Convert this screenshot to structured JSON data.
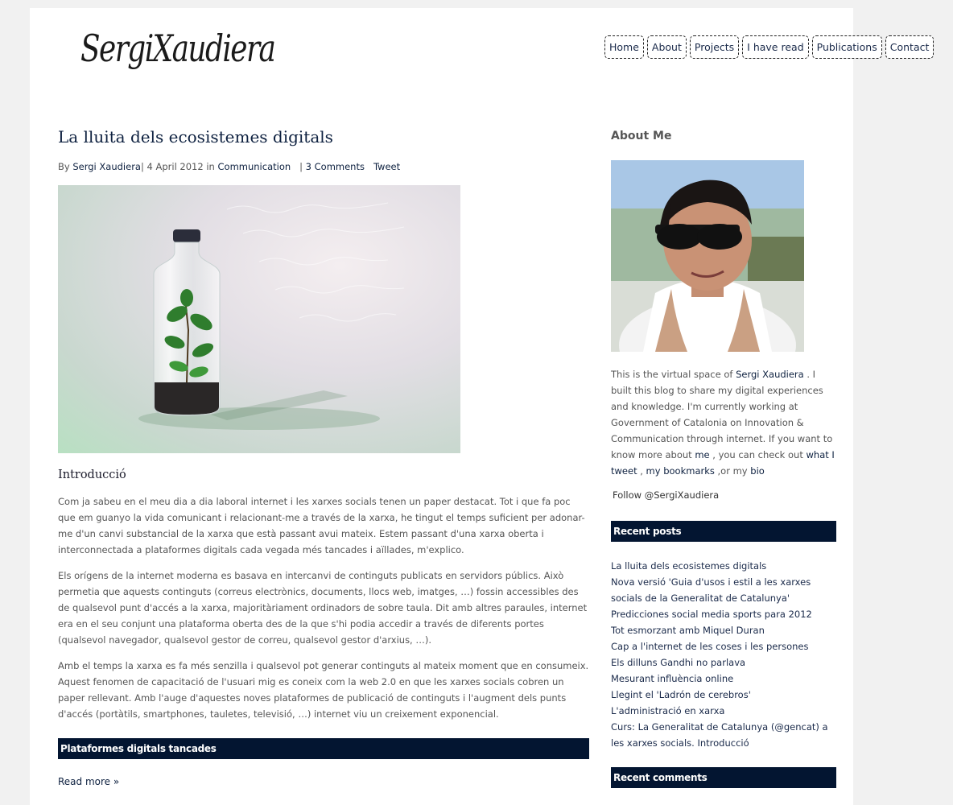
{
  "header": {
    "logo_text": "SergiXaudiera",
    "nav": [
      "Home",
      "About",
      "Projects",
      "I have read",
      "Publications",
      "Contact"
    ]
  },
  "post": {
    "title": "La lluita dels ecosistemes digitals",
    "meta": {
      "by": "By",
      "author": "Sergi Xaudiera",
      "date": "| 4 April 2012 in",
      "category": "Communication",
      "comments_sep": "|",
      "comments": "3 Comments",
      "tweet": "Tweet"
    },
    "intro_heading": "Introducció",
    "paragraphs": [
      "Com ja sabeu en el meu dia a dia laboral internet i les xarxes socials tenen un paper destacat. Tot i que fa poc que em guanyo la vida comunicant i relacionant-me a través de la xarxa, he tingut el temps suficient per adonar-me d'un canvi substancial de la xarxa que està passant avui mateix. Estem passant d'una xarxa oberta i interconnectada a plataformes digitals cada vegada més tancades i aïllades, m'explico.",
      "Els orígens de la internet moderna es basava en intercanvi de continguts publicats en servidors públics. Això permetia que aquests continguts (correus electrònics, documents, llocs web, imatges, …) fossin accessibles des de qualsevol punt d'accés a la xarxa, majoritàriament ordinadors de sobre taula. Dit amb altres paraules, internet era en el seu conjunt una plataforma oberta des de la que s'hi podia accedir a través de diferents portes (qualsevol navegador, qualsevol  gestor de correu, qualsevol gestor d'arxius, …).",
      "Amb el temps la xarxa es fa més senzilla i qualsevol pot generar continguts al mateix moment que en consumeix. Aquest fenomen de capacitació de l'usuari mig es coneix com la web 2.0 en que les xarxes socials cobren un paper rellevant. Amb l'auge d'aquestes noves plataformes de publicació de continguts i l'augment dels punts d'accés (portàtils, smartphones, tauletes, televisió, …) internet viu un creixement exponencial."
    ],
    "subheading": "Plataformes digitals tancades",
    "read_more": "Read more »"
  },
  "sidebar": {
    "about_title": "About Me",
    "bio": {
      "t1": "This is the virtual space of ",
      "l1": "Sergi Xaudiera",
      "t2": " . I built this blog to share my digital experiences and knowledge. I'm currently working at Government of Catalonia on Innovation & Communication through internet. If you want to know more about ",
      "l2": "me",
      "t3": " , you can check out ",
      "l3": "what I tweet",
      "t4": " , ",
      "l4": "my bookmarks",
      "t5": " ,or my ",
      "l5": "bio"
    },
    "follow": "Follow @SergiXaudiera",
    "recent_posts_title": "Recent posts",
    "recent_posts": [
      "La lluita dels ecosistemes digitals",
      "Nova versió 'Guia d'usos i estil a les xarxes socials de la Generalitat de Catalunya'",
      "Predicciones social media sports para 2012",
      "Tot esmorzant amb Miquel Duran",
      "Cap a l'internet de les coses i les persones",
      "Els dilluns Gandhi no parlava",
      "Mesurant influència online",
      "Llegint el 'Ladrón de cerebros'",
      "L'administració en xarxa",
      "Curs: La Generalitat de Catalunya (@gencat) a les xarxes socials. Introducció"
    ],
    "recent_comments_title": "Recent comments"
  }
}
